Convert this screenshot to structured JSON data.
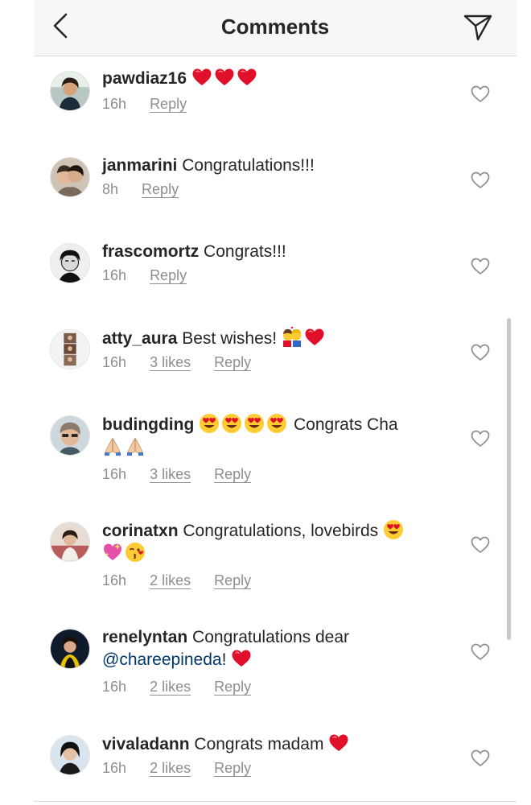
{
  "header": {
    "title": "Comments",
    "back_icon": "chevron-left-icon",
    "send_icon": "paper-plane-icon"
  },
  "colors": {
    "username": "#262626",
    "meta": "#8e8e8e",
    "heart_emoji": "#e0102b",
    "mention": "#00376b"
  },
  "comments": [
    {
      "username": "pawdiaz16",
      "text": "",
      "emojis": [
        "red-heart",
        "red-heart",
        "red-heart"
      ],
      "time": "16h",
      "likes": "",
      "reply": "Reply"
    },
    {
      "username": "janmarini",
      "text": "Congratulations!!!",
      "time": "8h",
      "likes": "",
      "reply": "Reply"
    },
    {
      "username": "frascomortz",
      "text": "Congrats!!!",
      "time": "16h",
      "likes": "",
      "reply": "Reply"
    },
    {
      "username": "atty_aura",
      "text": "Best wishes!",
      "emojis": [
        "couple-kiss",
        "red-heart"
      ],
      "time": "16h",
      "likes": "3 likes",
      "reply": "Reply"
    },
    {
      "username": "budingding",
      "text": "Congrats Cha",
      "emojis_before": [
        "heart-eyes",
        "heart-eyes",
        "heart-eyes",
        "heart-eyes"
      ],
      "emojis_after": [
        "folded-hands",
        "folded-hands"
      ],
      "time": "16h",
      "likes": "3 likes",
      "reply": "Reply"
    },
    {
      "username": "corinatxn",
      "text": "Congratulations, lovebirds",
      "emojis": [
        "heart-eyes",
        "sparkling-heart",
        "kissing-face"
      ],
      "time": "16h",
      "likes": "2 likes",
      "reply": "Reply"
    },
    {
      "username": "renelyntan",
      "text": "Congratulations dear",
      "mention": "@chareepineda",
      "after_mention": "!",
      "emojis": [
        "red-heart"
      ],
      "time": "16h",
      "likes": "2 likes",
      "reply": "Reply"
    },
    {
      "username": "vivaladann",
      "text": "Congrats madam",
      "emojis": [
        "red-heart"
      ],
      "time": "16h",
      "likes": "2 likes",
      "reply": "Reply"
    }
  ]
}
